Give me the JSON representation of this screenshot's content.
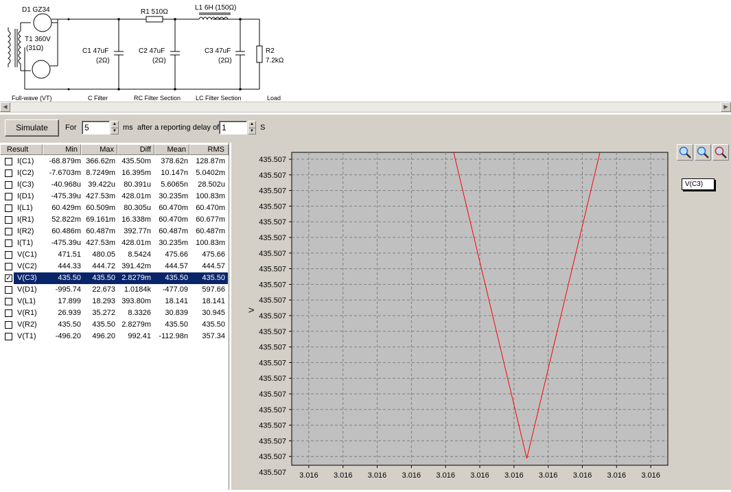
{
  "schematic": {
    "d1": "D1 GZ34",
    "t1": "T1 360V",
    "t1_res": "(31Ω)",
    "r1": "R1 510Ω",
    "l1": "L1 6H (150Ω)",
    "c1": "C1 47uF",
    "c1_res": "(2Ω)",
    "c2": "C2 47uF",
    "c2_res": "(2Ω)",
    "c3": "C3 47uF",
    "c3_res": "(2Ω)",
    "r2": "R2",
    "r2_val": "7.2kΩ",
    "sections": [
      "Full-wave (VT)",
      "C Filter",
      "RC Filter Section",
      "LC Filter Section",
      "Load"
    ]
  },
  "toolbar": {
    "simulate_label": "Simulate",
    "for_label": "For",
    "for_value": "5",
    "ms_label": "ms",
    "delay_label": "after a reporting delay of",
    "delay_value": "1",
    "s_label": "S"
  },
  "table": {
    "headers": [
      "Result",
      "Min",
      "Max",
      "Diff",
      "Mean",
      "RMS"
    ],
    "rows": [
      {
        "name": "I(C1)",
        "min": "-68.879m",
        "max": "366.62m",
        "diff": "435.50m",
        "mean": "378.62n",
        "rms": "128.87m",
        "checked": false
      },
      {
        "name": "I(C2)",
        "min": "-7.6703m",
        "max": "8.7249m",
        "diff": "16.395m",
        "mean": "10.147n",
        "rms": "5.0402m",
        "checked": false
      },
      {
        "name": "I(C3)",
        "min": "-40.968u",
        "max": "39.422u",
        "diff": "80.391u",
        "mean": "5.6065n",
        "rms": "28.502u",
        "checked": false
      },
      {
        "name": "I(D1)",
        "min": "-475.39u",
        "max": "427.53m",
        "diff": "428.01m",
        "mean": "30.235m",
        "rms": "100.83m",
        "checked": false
      },
      {
        "name": "I(L1)",
        "min": "60.429m",
        "max": "60.509m",
        "diff": "80.305u",
        "mean": "60.470m",
        "rms": "60.470m",
        "checked": false
      },
      {
        "name": "I(R1)",
        "min": "52.822m",
        "max": "69.161m",
        "diff": "16.338m",
        "mean": "60.470m",
        "rms": "60.677m",
        "checked": false
      },
      {
        "name": "I(R2)",
        "min": "60.486m",
        "max": "60.487m",
        "diff": "392.77n",
        "mean": "60.487m",
        "rms": "60.487m",
        "checked": false
      },
      {
        "name": "I(T1)",
        "min": "-475.39u",
        "max": "427.53m",
        "diff": "428.01m",
        "mean": "30.235m",
        "rms": "100.83m",
        "checked": false
      },
      {
        "name": "V(C1)",
        "min": "471.51",
        "max": "480.05",
        "diff": "8.5424",
        "mean": "475.66",
        "rms": "475.66",
        "checked": false
      },
      {
        "name": "V(C2)",
        "min": "444.33",
        "max": "444.72",
        "diff": "391.42m",
        "mean": "444.57",
        "rms": "444.57",
        "checked": false
      },
      {
        "name": "V(C3)",
        "min": "435.50",
        "max": "435.50",
        "diff": "2.8279m",
        "mean": "435.50",
        "rms": "435.50",
        "checked": true
      },
      {
        "name": "V(D1)",
        "min": "-995.74",
        "max": "22.673",
        "diff": "1.0184k",
        "mean": "-477.09",
        "rms": "597.66",
        "checked": false
      },
      {
        "name": "V(L1)",
        "min": "17.899",
        "max": "18.293",
        "diff": "393.80m",
        "mean": "18.141",
        "rms": "18.141",
        "checked": false
      },
      {
        "name": "V(R1)",
        "min": "26.939",
        "max": "35.272",
        "diff": "8.3326",
        "mean": "30.839",
        "rms": "30.945",
        "checked": false
      },
      {
        "name": "V(R2)",
        "min": "435.50",
        "max": "435.50",
        "diff": "2.8279m",
        "mean": "435.50",
        "rms": "435.50",
        "checked": false
      },
      {
        "name": "V(T1)",
        "min": "-496.20",
        "max": "496.20",
        "diff": "992.41",
        "mean": "-112.98n",
        "rms": "357.34",
        "checked": false
      }
    ]
  },
  "zoom_buttons": [
    "zoom-in-icon",
    "zoom-fit-icon",
    "zoom-out-icon"
  ],
  "legend_label": "V(C3)",
  "colors": {
    "selection": "#0a246a",
    "trace": "#ff0000",
    "plot_bg": "#c0c0c0",
    "panel": "#d4d0c8"
  },
  "chart_data": {
    "type": "line",
    "ylabel": "V",
    "xlabel": "",
    "y_tick_labels": [
      "435.507",
      "435.507",
      "435.507",
      "435.507",
      "435.507",
      "435.507",
      "435.507",
      "435.507",
      "435.507",
      "435.507",
      "435.507",
      "435.507",
      "435.507",
      "435.507",
      "435.507",
      "435.507",
      "435.507",
      "435.507",
      "435.507",
      "435.507",
      "435.507"
    ],
    "x_tick_labels": [
      "3.016",
      "3.016",
      "3.016",
      "3.016",
      "3.016",
      "3.016",
      "3.016",
      "3.016",
      "3.016",
      "3.016",
      "3.016"
    ],
    "grid": true,
    "series": [
      {
        "name": "V(C3)",
        "color": "#ff0000",
        "x": [
          3.01587,
          3.016,
          3.01613
        ],
        "y": [
          435.50748,
          435.50701,
          435.50748
        ]
      }
    ],
    "x_range": [
      3.0156,
      3.01624
    ],
    "y_range": [
      435.507,
      435.50746
    ]
  }
}
